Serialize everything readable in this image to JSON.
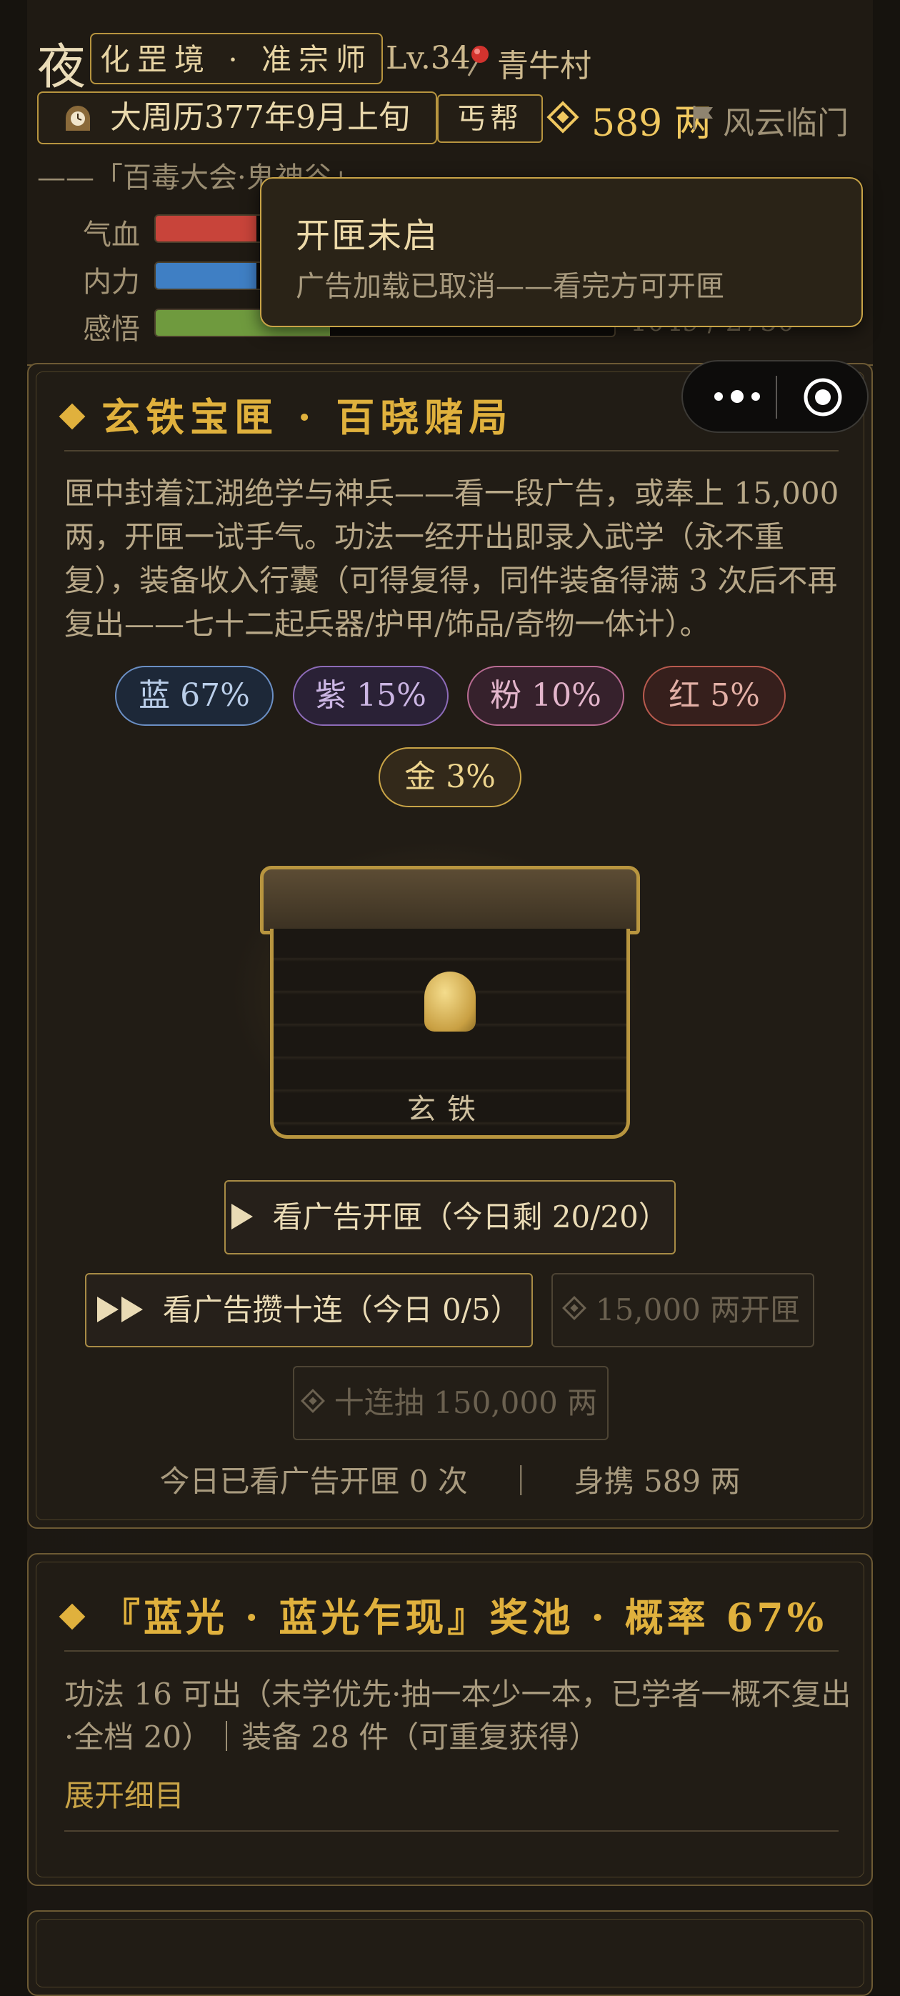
{
  "header": {
    "night_char": "夜",
    "realm": "化罡境 · 准宗师",
    "level": "Lv.34",
    "village": "青牛村",
    "date": "大周历377年9月上旬",
    "sect": "丐帮",
    "money": "589 两",
    "fengyun": "风云临门",
    "event": "——「百毒大会·鬼神谷」",
    "stats": [
      {
        "label": "气血",
        "color": "#c8443a",
        "fill": 0.22
      },
      {
        "label": "内力",
        "color": "#3f7fc4",
        "fill": 0.22
      },
      {
        "label": "感悟",
        "color": "#6f9a3e",
        "fill": 0.38,
        "value": "1049 / 2750"
      }
    ]
  },
  "tooltip": {
    "title": "开匣未启",
    "message": "广告加载已取消——看完方可开匣"
  },
  "capsule": {
    "more_icon": "more-dots-icon",
    "close_icon": "target-circle-icon"
  },
  "chest_card": {
    "title": "玄铁宝匣 · 百晓赌局",
    "description": "匣中封着江湖绝学与神兵——看一段广告，或奉上 15,000 两，开匣一试手气。功法一经开出即录入武学（永不重复），装备收入行囊（可得复得，同件装备得满 3 次后不再复出——七十二起兵器/护甲/饰品/奇物一体计）。",
    "rarities": [
      {
        "label": "蓝 67%",
        "color": "#6b8fc4",
        "bg": "#1d2838",
        "text": "#b9cde8"
      },
      {
        "label": "紫 15%",
        "color": "#8d6bb8",
        "bg": "#2a2136",
        "text": "#cbb5e3"
      },
      {
        "label": "粉 10%",
        "color": "#b86b92",
        "bg": "#36212c",
        "text": "#e3b5cb"
      },
      {
        "label": "红 5%",
        "color": "#b85a4e",
        "bg": "#361f1c",
        "text": "#e3b0a6"
      },
      {
        "label": "金 3%",
        "color": "#c9a447",
        "bg": "#33291a",
        "text": "#eed58e"
      }
    ],
    "chest_label": "玄铁",
    "btn_watch_ad": "看广告开匣（今日剩 20/20）",
    "btn_ten_ad": "看广告攒十连（今日 0/5）",
    "btn_pay": "15,000 两开匣",
    "btn_ten_pay": "十连抽 150,000 两",
    "footer_left": "今日已看广告开匣 0 次",
    "footer_sep": "｜",
    "footer_right": "身携 589 两"
  },
  "pool_card": {
    "title": "『蓝光 · 蓝光乍现』奖池 · 概率 67%",
    "description": "功法 16 可出（未学优先·抽一本少一本，已学者一概不复出·全档 20）｜装备 28 件（可重复获得）",
    "expand": "展开细目"
  }
}
